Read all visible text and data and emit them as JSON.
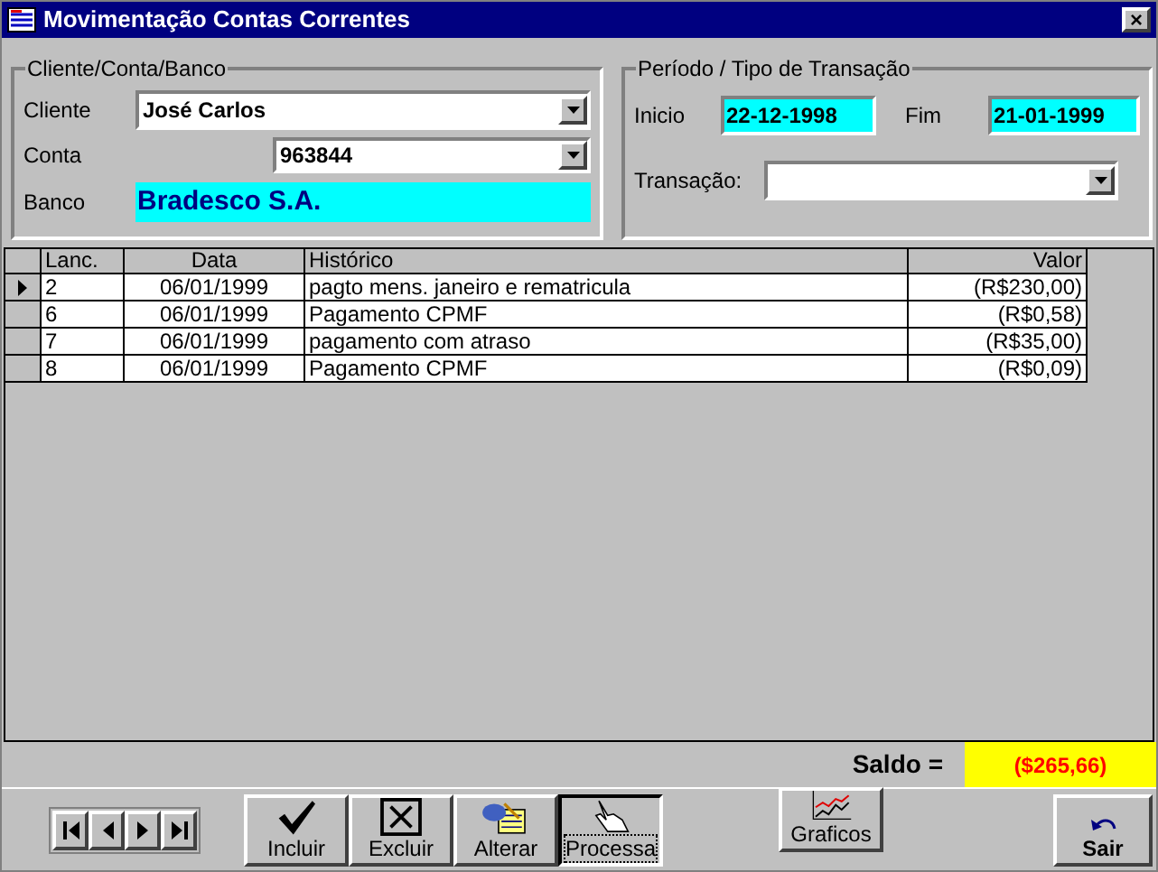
{
  "window": {
    "title": "Movimentação Contas Correntes",
    "close": "×"
  },
  "cliente_group": {
    "legend": "Cliente/Conta/Banco",
    "cliente_label": "Cliente",
    "cliente_value": "José Carlos",
    "conta_label": "Conta",
    "conta_value": "963844",
    "banco_label": "Banco",
    "banco_value": "Bradesco S.A."
  },
  "periodo_group": {
    "legend": "Período / Tipo de Transação",
    "inicio_label": "Inicio",
    "inicio_value": "22-12-1998",
    "fim_label": "Fim",
    "fim_value": "21-01-1999",
    "transacao_label": "Transação:"
  },
  "table": {
    "columns": [
      "Lanc.",
      "Data",
      "Histórico",
      "Valor"
    ],
    "rows": [
      {
        "selected": true,
        "cells": [
          "2",
          "06/01/1999",
          "pagto mens. janeiro e rematricula",
          "(R$230,00)"
        ]
      },
      {
        "selected": false,
        "cells": [
          "6",
          "06/01/1999",
          "Pagamento CPMF",
          "(R$0,58)"
        ]
      },
      {
        "selected": false,
        "cells": [
          "7",
          "06/01/1999",
          "pagamento com atraso",
          "(R$35,00)"
        ]
      },
      {
        "selected": false,
        "cells": [
          "8",
          "06/01/1999",
          "Pagamento CPMF",
          "(R$0,09)"
        ]
      }
    ]
  },
  "saldo": {
    "label": "Saldo =",
    "value": "($265,66)"
  },
  "toolbar": [
    {
      "kind": "check",
      "label": "Incluir",
      "pressed": false
    },
    {
      "kind": "delete",
      "label": "Excluir",
      "pressed": false
    },
    {
      "kind": "edit",
      "label": "Alterar",
      "pressed": false
    },
    {
      "kind": "hand",
      "label": "Processa",
      "pressed": true
    },
    {
      "kind": "chart",
      "label": "Graficos",
      "pressed": false
    },
    {
      "kind": "undo",
      "label": "Sair",
      "pressed": false
    }
  ]
}
